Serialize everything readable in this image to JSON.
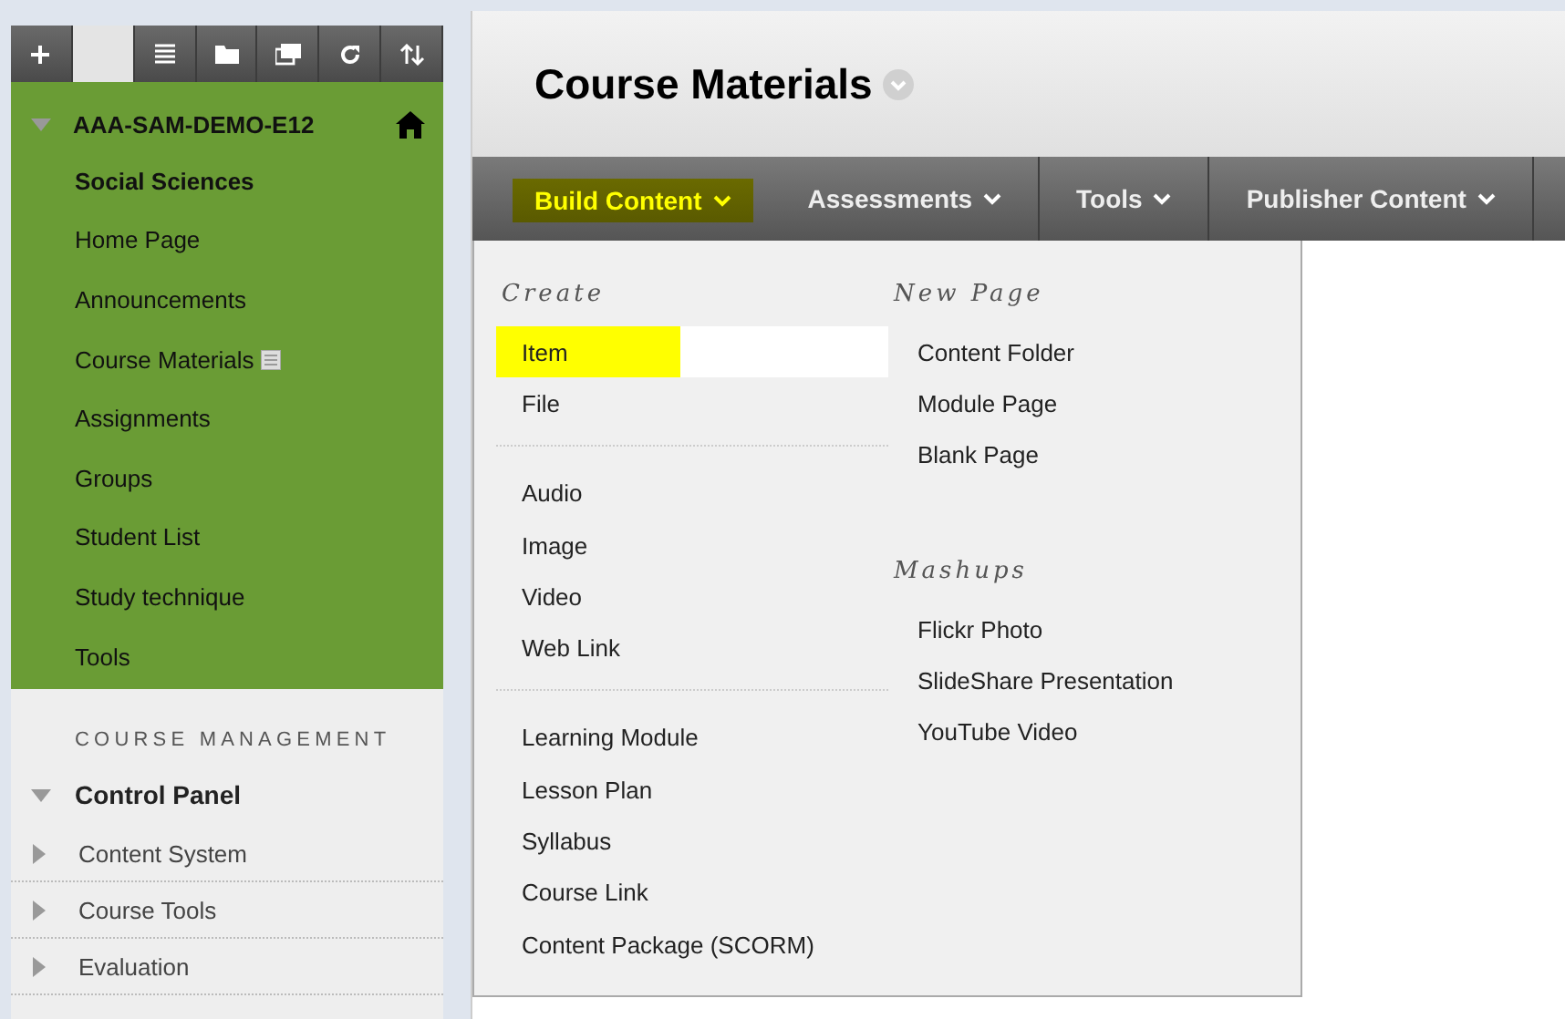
{
  "toolbar": [
    {
      "kind": "plus",
      "selected": false
    },
    {
      "kind": "blank",
      "selected": true
    },
    {
      "kind": "list",
      "selected": false
    },
    {
      "kind": "folder",
      "selected": false
    },
    {
      "kind": "window",
      "selected": false
    },
    {
      "kind": "refresh",
      "selected": false
    },
    {
      "kind": "sort",
      "selected": false
    }
  ],
  "course": {
    "title": "AAA-SAM-DEMO-E12",
    "expanded": true
  },
  "course_menu": [
    {
      "label": "Social Sciences",
      "selected": true,
      "badge": false
    },
    {
      "label": "Home Page",
      "selected": false,
      "badge": false
    },
    {
      "label": "Announcements",
      "selected": false,
      "badge": false
    },
    {
      "label": "Course Materials",
      "selected": false,
      "badge": true
    },
    {
      "label": "Assignments",
      "selected": false,
      "badge": false
    },
    {
      "label": "Groups",
      "selected": false,
      "badge": false
    },
    {
      "label": "Student List",
      "selected": false,
      "badge": false
    },
    {
      "label": "Study technique",
      "selected": false,
      "badge": false
    },
    {
      "label": "Tools",
      "selected": false,
      "badge": false
    }
  ],
  "management": {
    "heading": "COURSE MANAGEMENT",
    "panel": {
      "label": "Control Panel",
      "expanded": true
    },
    "items": [
      {
        "label": "Content System",
        "expanded": false
      },
      {
        "label": "Course Tools",
        "expanded": false
      },
      {
        "label": "Evaluation",
        "expanded": false
      }
    ]
  },
  "page_title": "Course Materials",
  "nav": [
    {
      "label": "Build Content",
      "selected": true
    },
    {
      "label": "Assessments",
      "selected": false
    },
    {
      "label": "Tools",
      "selected": false
    },
    {
      "label": "Publisher Content",
      "selected": false
    }
  ],
  "menu_columns": [
    [
      {
        "heading": "Create",
        "groups": [
          [
            {
              "label": "Item",
              "selected": true
            },
            {
              "label": "File",
              "selected": false
            }
          ],
          [
            {
              "label": "Audio",
              "selected": false
            },
            {
              "label": "Image",
              "selected": false
            },
            {
              "label": "Video",
              "selected": false
            },
            {
              "label": "Web Link",
              "selected": false
            }
          ],
          [
            {
              "label": "Learning Module",
              "selected": false
            },
            {
              "label": "Lesson Plan",
              "selected": false
            },
            {
              "label": "Syllabus",
              "selected": false
            },
            {
              "label": "Course Link",
              "selected": false
            },
            {
              "label": "Content Package (SCORM)",
              "selected": false
            }
          ]
        ]
      }
    ],
    [
      {
        "heading": "New Page",
        "groups": [
          [
            {
              "label": "Content Folder",
              "selected": false
            },
            {
              "label": "Module Page",
              "selected": false
            },
            {
              "label": "Blank Page",
              "selected": false
            }
          ]
        ]
      },
      {
        "heading": "Mashups",
        "groups": [
          [
            {
              "label": "Flickr Photo",
              "selected": false
            },
            {
              "label": "SlideShare Presentation",
              "selected": false
            },
            {
              "label": "YouTube Video",
              "selected": false
            }
          ]
        ]
      }
    ]
  ]
}
